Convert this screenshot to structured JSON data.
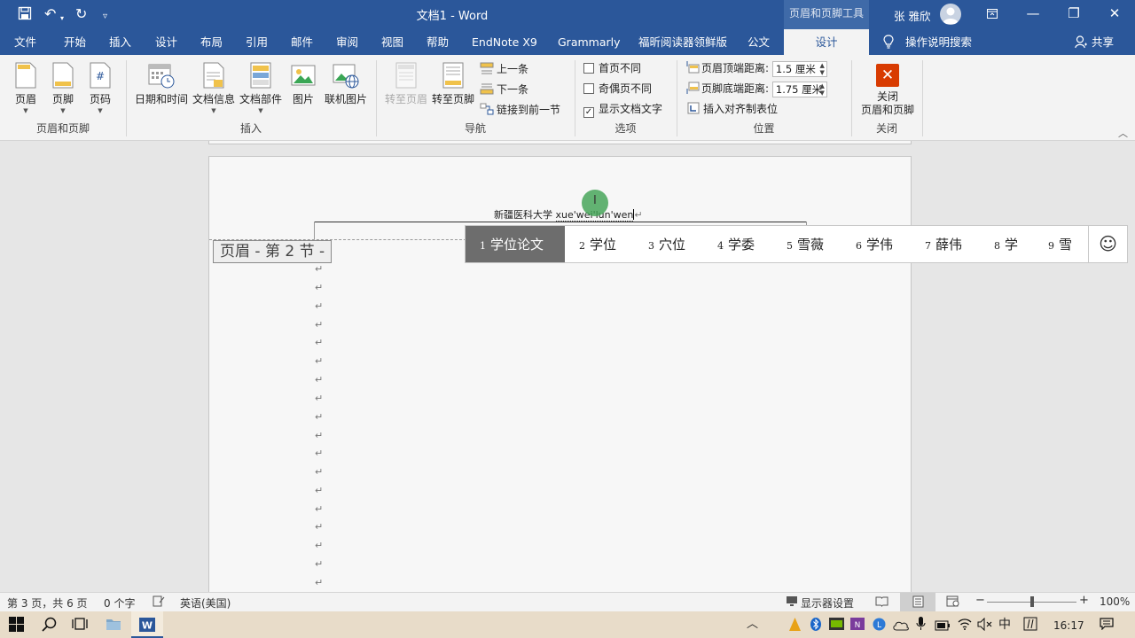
{
  "window": {
    "title": "文档1  -  Word",
    "contextual_tab_group": "页眉和页脚工具",
    "user_name": "张 雅欣"
  },
  "tabs": [
    "文件",
    "开始",
    "插入",
    "设计",
    "布局",
    "引用",
    "邮件",
    "审阅",
    "视图",
    "帮助",
    "EndNote X9",
    "Grammarly",
    "福昕阅读器领鲜版",
    "公文",
    "设计"
  ],
  "tell_me": "操作说明搜索",
  "share": "共享",
  "ribbon": {
    "groups": {
      "header_footer": {
        "label": "页眉和页脚",
        "buttons": [
          "页眉",
          "页脚",
          "页码"
        ]
      },
      "insert": {
        "label": "插入",
        "buttons": [
          "日期和时间",
          "文档信息",
          "文档部件",
          "图片",
          "联机图片"
        ]
      },
      "navigation": {
        "label": "导航",
        "goto_header": "转至页眉",
        "goto_footer": "转至页脚",
        "previous": "上一条",
        "next": "下一条",
        "link_previous": "链接到前一节"
      },
      "options": {
        "label": "选项",
        "different_first_page": "首页不同",
        "different_odd_even": "奇偶页不同",
        "show_document_text": "显示文档文字",
        "different_first_page_checked": false,
        "different_odd_even_checked": false,
        "show_document_text_checked": true
      },
      "position": {
        "label": "位置",
        "header_top_label": "页眉顶端距离:",
        "header_top_value": "1.5 厘米",
        "footer_bottom_label": "页脚底端距离:",
        "footer_bottom_value": "1.75 厘米",
        "insert_alignment_tab": "插入对齐制表位"
      },
      "close": {
        "label": "关闭",
        "button_line1": "关闭",
        "button_line2": "页眉和页脚"
      }
    }
  },
  "document": {
    "header_text": "新疆医科大学",
    "composition_text": "xue'wei'lun'wen",
    "header_tag": "页眉 - 第 2 节 -",
    "paragraph_mark": "↵"
  },
  "ime": {
    "candidates": [
      {
        "n": "1",
        "text": "学位论文"
      },
      {
        "n": "2",
        "text": "学位"
      },
      {
        "n": "3",
        "text": "穴位"
      },
      {
        "n": "4",
        "text": "学委"
      },
      {
        "n": "5",
        "text": "雪薇"
      },
      {
        "n": "6",
        "text": "学伟"
      },
      {
        "n": "7",
        "text": "薛伟"
      },
      {
        "n": "8",
        "text": "学"
      },
      {
        "n": "9",
        "text": "雪"
      }
    ],
    "emoji_glyph": "☺"
  },
  "status": {
    "page": "第 3 页，共 6 页",
    "words": "0 个字",
    "language": "英语(美国)",
    "display_settings": "显示器设置",
    "zoom": "100%"
  },
  "taskbar": {
    "time": "16:17",
    "ime_mode": "中"
  },
  "colors": {
    "word_blue": "#2b579a",
    "close_red": "#d83b01",
    "ime_selected": "#6d6d6d"
  }
}
